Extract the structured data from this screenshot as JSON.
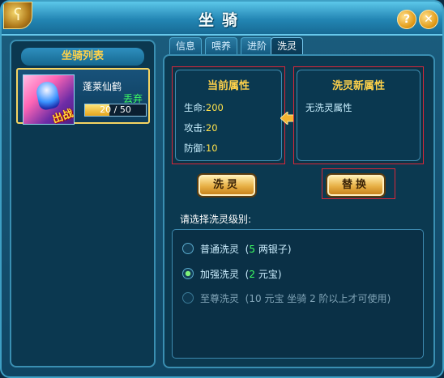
{
  "window": {
    "title": "坐骑",
    "help_label": "?",
    "close_label": "✕"
  },
  "left_panel": {
    "header": "坐骑列表",
    "mount": {
      "name": "蓬莱仙鹤",
      "discard_label": "丢弃",
      "badge": "出战",
      "exp_current": 20,
      "exp_max": 50,
      "exp_text": "20 / 50"
    }
  },
  "tabs": [
    {
      "label": "信息",
      "active": false
    },
    {
      "label": "喂养",
      "active": false
    },
    {
      "label": "进阶",
      "active": false
    },
    {
      "label": "洗灵",
      "active": true
    }
  ],
  "current_attrs": {
    "title": "当前属性",
    "items": [
      {
        "label": "生命:",
        "value": "200"
      },
      {
        "label": "攻击:",
        "value": "20"
      },
      {
        "label": "防御:",
        "value": "10"
      }
    ]
  },
  "new_attrs": {
    "title": "洗灵新属性",
    "empty_text": "无洗灵属性"
  },
  "buttons": {
    "wash": "洗灵",
    "replace": "替换"
  },
  "level_prompt": "请选择洗灵级别:",
  "options": [
    {
      "name": "普通洗灵",
      "open": "(",
      "num": "5",
      "unit": "两银子",
      "extra": "",
      "close": ")",
      "checked": false,
      "disabled": false
    },
    {
      "name": "加强洗灵",
      "open": "(",
      "num": "2",
      "unit": "元宝",
      "extra": "",
      "close": ")",
      "checked": true,
      "disabled": false
    },
    {
      "name": "至尊洗灵",
      "open": "(",
      "num": "10",
      "unit": "元宝",
      "extra": "坐骑 2 阶以上才可使用",
      "close": ")",
      "checked": false,
      "disabled": true
    }
  ],
  "colors": {
    "accent_gold": "#ffd24a",
    "value_yellow": "#ffe14a",
    "highlight_red": "#d9273a",
    "number_green": "#3dff62"
  }
}
